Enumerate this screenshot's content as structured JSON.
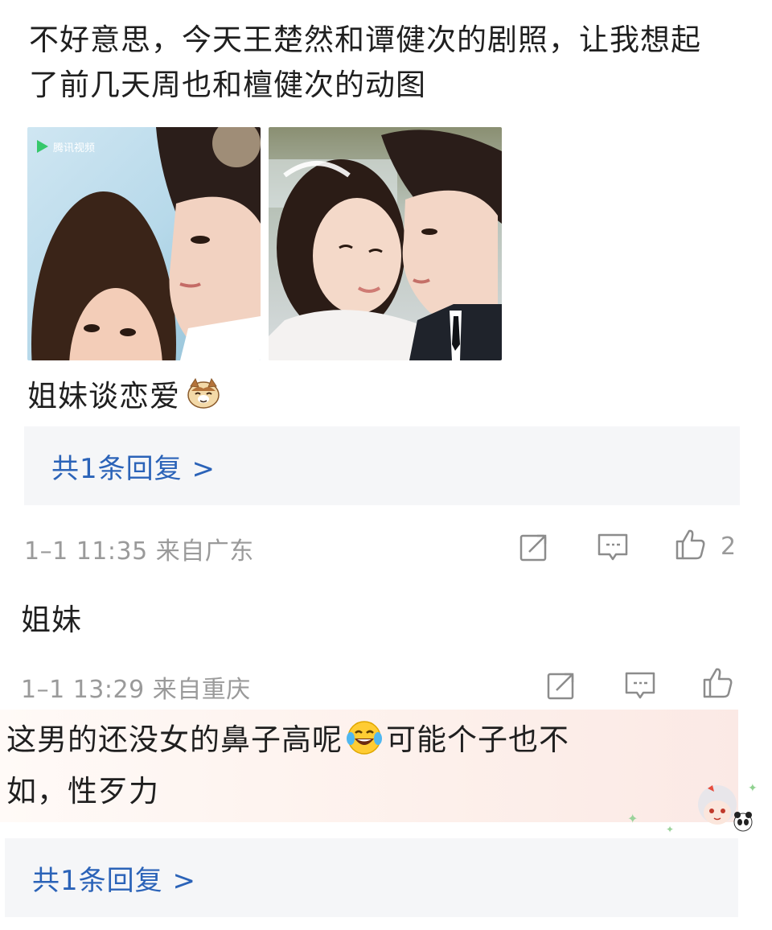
{
  "comment1": {
    "text_line1": "不好意思，今天王楚然和谭健次的剧照，让我想起",
    "text_line2": "了前几天周也和檀健次的动图",
    "images": [
      {
        "watermark": "腾讯视频"
      },
      {
        "watermark": ""
      }
    ],
    "subtext": "姐妹谈恋爱",
    "emoji": "cat-face-emoji",
    "reply_label": "共1条回复 >",
    "meta": "1–1 11:35 来自广东",
    "like_count": "2"
  },
  "comment2": {
    "text": "姐妹",
    "meta": "1–1 13:29 来自重庆",
    "like_count": ""
  },
  "comment3": {
    "text_before": "这男的还没女的鼻子高呢",
    "emoji": "tears-of-joy-emoji",
    "text_after_line1": "可能个子也不",
    "text_line2": "如，性歹力",
    "reply_label": "共1条回复 >"
  },
  "colors": {
    "link": "#2b63b8",
    "meta": "#9a9a9a",
    "reply_bg": "#f5f6f8"
  },
  "icons": [
    "share-icon",
    "comment-icon",
    "like-icon"
  ]
}
